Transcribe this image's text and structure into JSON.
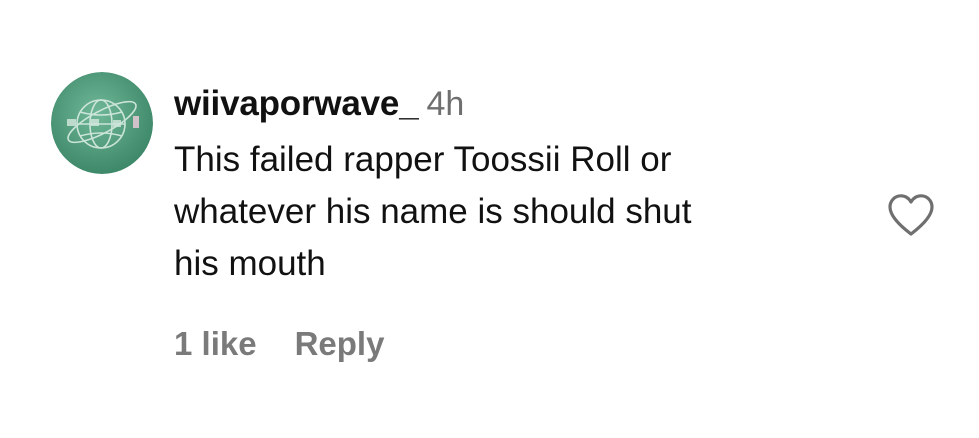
{
  "comment": {
    "username": "wiivaporwave_",
    "timestamp": "4h",
    "text_lines": [
      "This failed rapper Toossii Roll or",
      "whatever his name is should shut",
      "his mouth"
    ],
    "likes_label": "1 like",
    "reply_label": "Reply",
    "icons": {
      "avatar": "globe-avatar-icon",
      "like": "heart-icon"
    },
    "colors": {
      "text": "#111111",
      "muted": "#7a7a7a",
      "avatar_bg": "#4f9a7c"
    }
  }
}
